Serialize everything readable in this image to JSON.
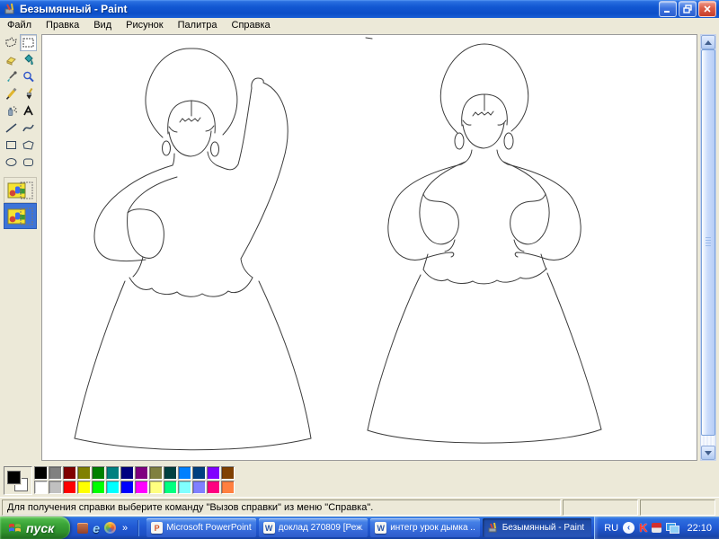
{
  "window": {
    "title": "Безымянный - Paint"
  },
  "menu": {
    "items": [
      "Файл",
      "Правка",
      "Вид",
      "Рисунок",
      "Палитра",
      "Справка"
    ]
  },
  "toolbox": {
    "tools": [
      "free-form-select",
      "select",
      "eraser",
      "fill",
      "pick-color",
      "magnifier",
      "pencil",
      "brush",
      "airbrush",
      "text",
      "line",
      "curve",
      "rectangle",
      "polygon",
      "ellipse",
      "rounded-rectangle"
    ],
    "selected_tool": "select",
    "selection_options": {
      "items": [
        "opaque",
        "transparent"
      ],
      "selected": "transparent"
    }
  },
  "canvas": {
    "description": "Line drawing of two Dymkovo-style doll figures with kokoshnik headdresses and bell skirts; left figure has right arm raised, right figure has both hands on hips."
  },
  "palette": {
    "foreground": "#000000",
    "background": "#FFFFFF",
    "row1": [
      "#000000",
      "#808080",
      "#800000",
      "#808000",
      "#008000",
      "#008080",
      "#000080",
      "#800080",
      "#808040",
      "#004040",
      "#0080FF",
      "#004080",
      "#8000FF",
      "#804000"
    ],
    "row2": [
      "#FFFFFF",
      "#C0C0C0",
      "#FF0000",
      "#FFFF00",
      "#00FF00",
      "#00FFFF",
      "#0000FF",
      "#FF00FF",
      "#FFFF80",
      "#00FF80",
      "#80FFFF",
      "#8080FF",
      "#FF0080",
      "#FF8040"
    ]
  },
  "statusbar": {
    "help_text": "Для получения справки выберите команду \"Вызов справки\" из меню \"Справка\"."
  },
  "taskbar": {
    "start": {
      "label": "пуск"
    },
    "quick_launch": {
      "ie_glyph": "e",
      "overflow_chevron": "»"
    },
    "buttons": [
      {
        "label": "Microsoft PowerPoint ...",
        "icon_glyph": "P",
        "active": false
      },
      {
        "label": "доклад 270809 [Реж...",
        "icon_glyph": "W",
        "active": false
      },
      {
        "label": "интегр урок дымка ...",
        "icon_glyph": "W",
        "active": false
      },
      {
        "label": "Безымянный - Paint",
        "active": true
      }
    ],
    "tray": {
      "language": "RU",
      "chevron_glyph": "‹",
      "kaspersky_glyph": "K",
      "time": "22:10"
    }
  }
}
